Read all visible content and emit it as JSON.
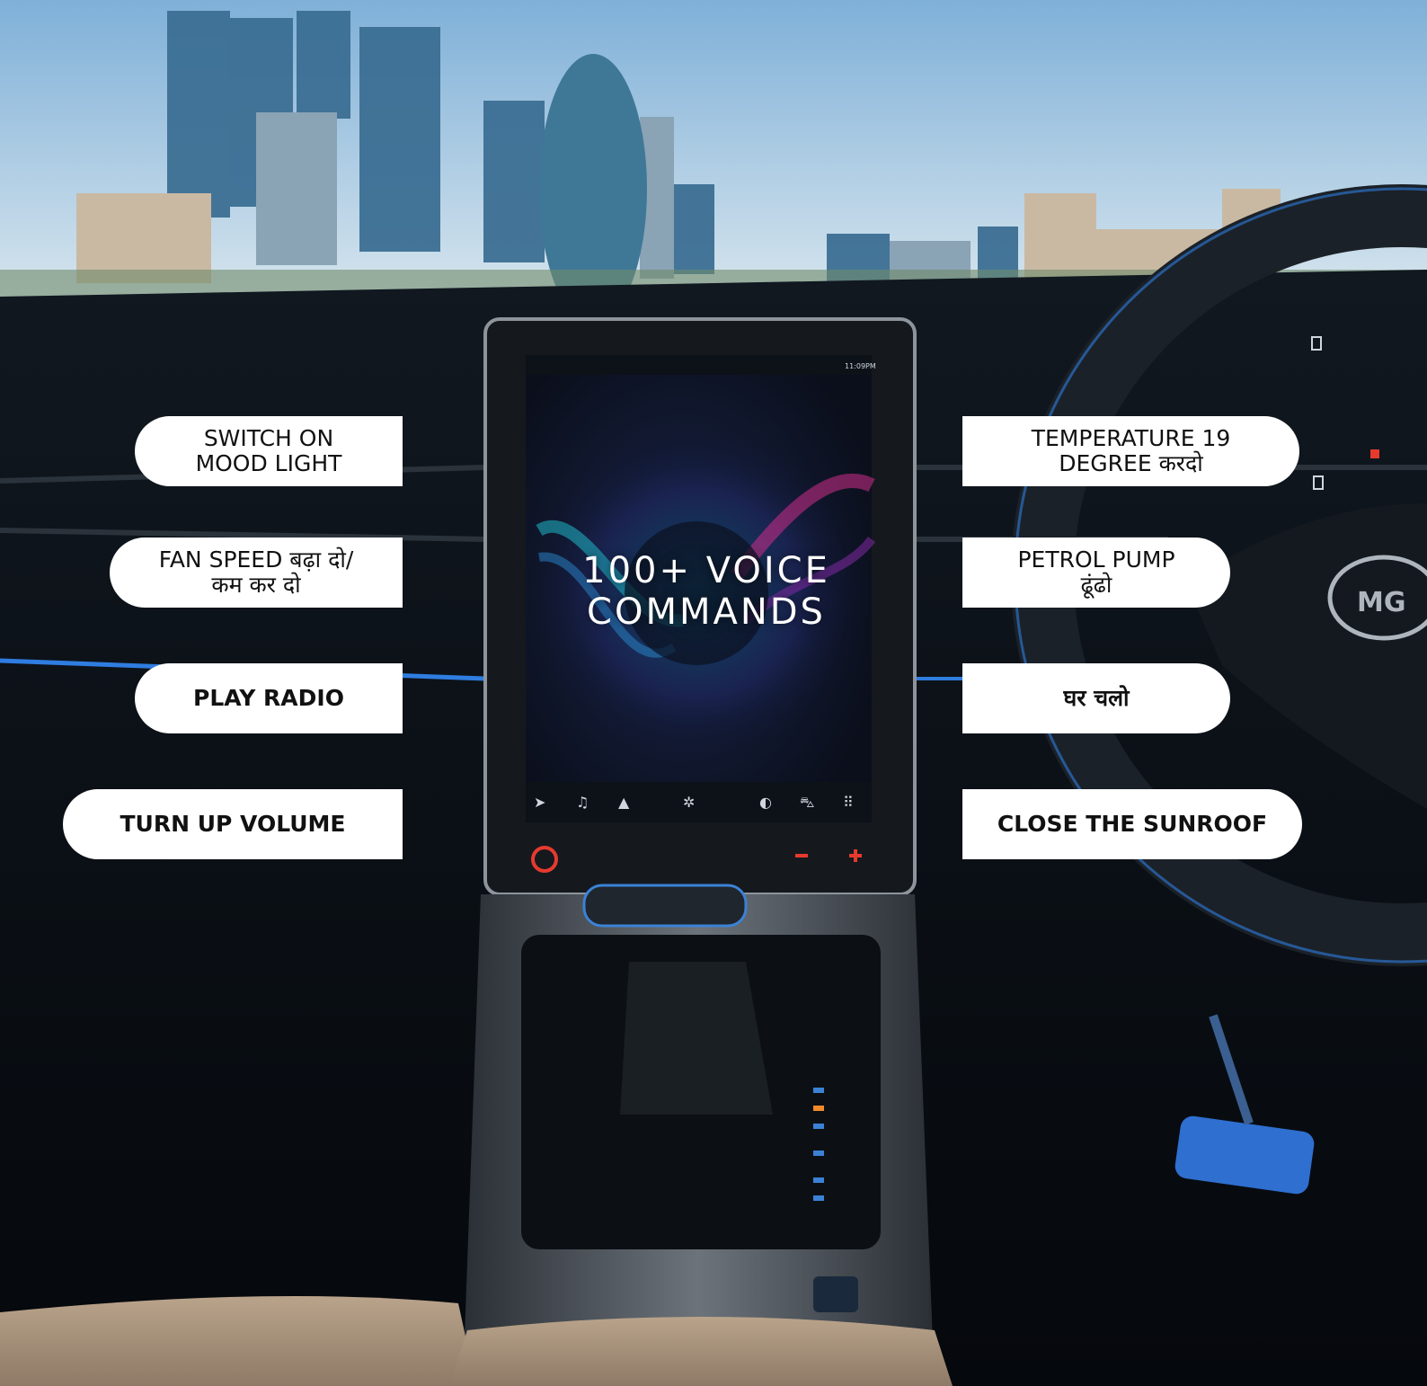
{
  "headline": "100+ VOICE\nCOMMANDS",
  "status_bar": {
    "time": "11:09PM"
  },
  "commands_left": [
    {
      "text": "SWITCH ON\nMOOD LIGHT",
      "bold": false
    },
    {
      "text": "FAN SPEED बढ़ा दो/\nकम कर दो",
      "bold": false
    },
    {
      "text": "PLAY RADIO",
      "bold": true
    },
    {
      "text": "TURN UP VOLUME",
      "bold": true
    }
  ],
  "commands_right": [
    {
      "text": "TEMPERATURE 19\nDEGREE करदो",
      "bold": false
    },
    {
      "text": "PETROL PUMP\nढूंढो",
      "bold": false
    },
    {
      "text": "घर चलो",
      "bold": true
    },
    {
      "text": "CLOSE THE SUNROOF",
      "bold": true
    }
  ],
  "icons": [
    "wifi-icon",
    "signal-icon",
    "bluetooth-icon",
    "navigation-icon",
    "music-icon",
    "android-auto-icon",
    "ac-fan-icon",
    "apple-carplay-icon",
    "car-icon",
    "apps-grid-icon",
    "power-button-icon",
    "volume-down-icon",
    "volume-up-icon"
  ],
  "colors": {
    "bubble": "#ffffff",
    "accent_red": "#e63a2e",
    "ambient_blue": "#2f7de0"
  }
}
